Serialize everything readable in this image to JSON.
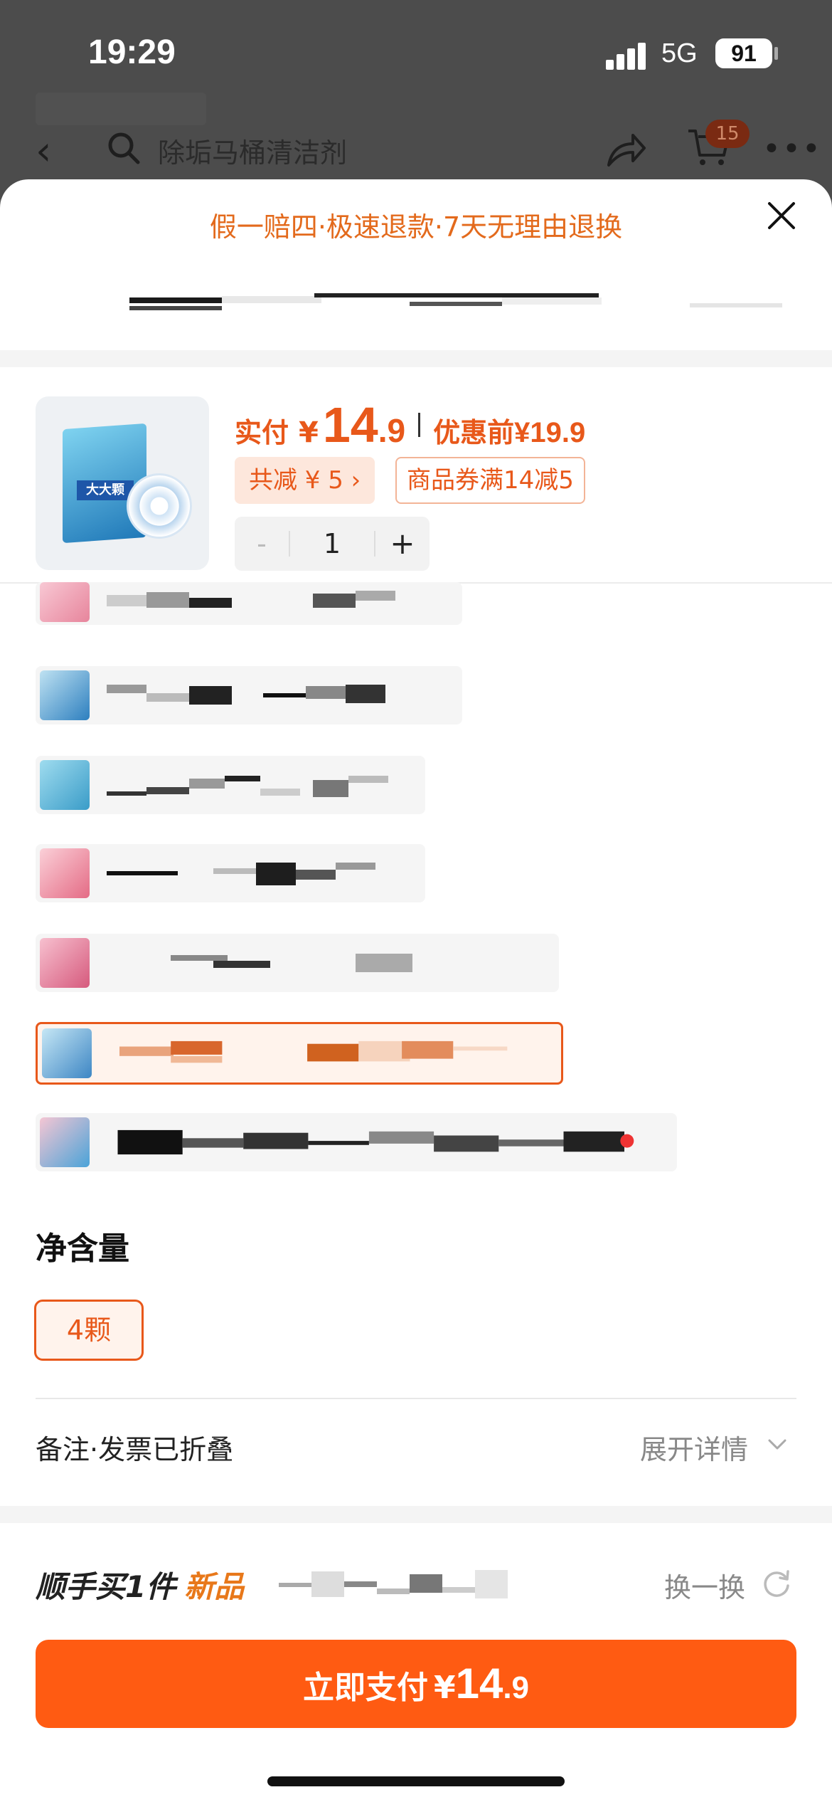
{
  "status_bar": {
    "time": "19:29",
    "network": "5G",
    "battery": "91"
  },
  "background_page": {
    "search_text": "除垢马桶清洁剂",
    "cart_badge": "15"
  },
  "sheet": {
    "guarantee_text": "假一赔四·极速退款·7天无理由退换",
    "product": {
      "pay_label": "实付",
      "currency": "¥",
      "price_int": "14",
      "price_dec": ".9",
      "before_label": "优惠前",
      "before_price": "¥19.9",
      "discount_text": "共减 ¥ 5 ›",
      "coupon_text": "商品券满14减5",
      "quantity": "1",
      "minus": "-",
      "plus": "+"
    },
    "variants": [
      {
        "selected": false
      },
      {
        "selected": false
      },
      {
        "selected": false
      },
      {
        "selected": false
      },
      {
        "selected": false
      },
      {
        "selected": true
      },
      {
        "selected": false
      }
    ],
    "net_content": {
      "title": "净含量",
      "option": "4颗"
    },
    "remark": {
      "label": "备注·发票已折叠",
      "expand": "展开详情"
    },
    "bundle": {
      "title": "顺手买1件",
      "new_tag": "新品",
      "swap": "换一换"
    },
    "pay_button": {
      "label": "立即支付",
      "currency": "¥",
      "price_int": "14",
      "price_dec": ".9"
    }
  },
  "colors": {
    "accent": "#e8581a",
    "button": "#ff5b12",
    "chip_bg": "#fde7dc"
  }
}
